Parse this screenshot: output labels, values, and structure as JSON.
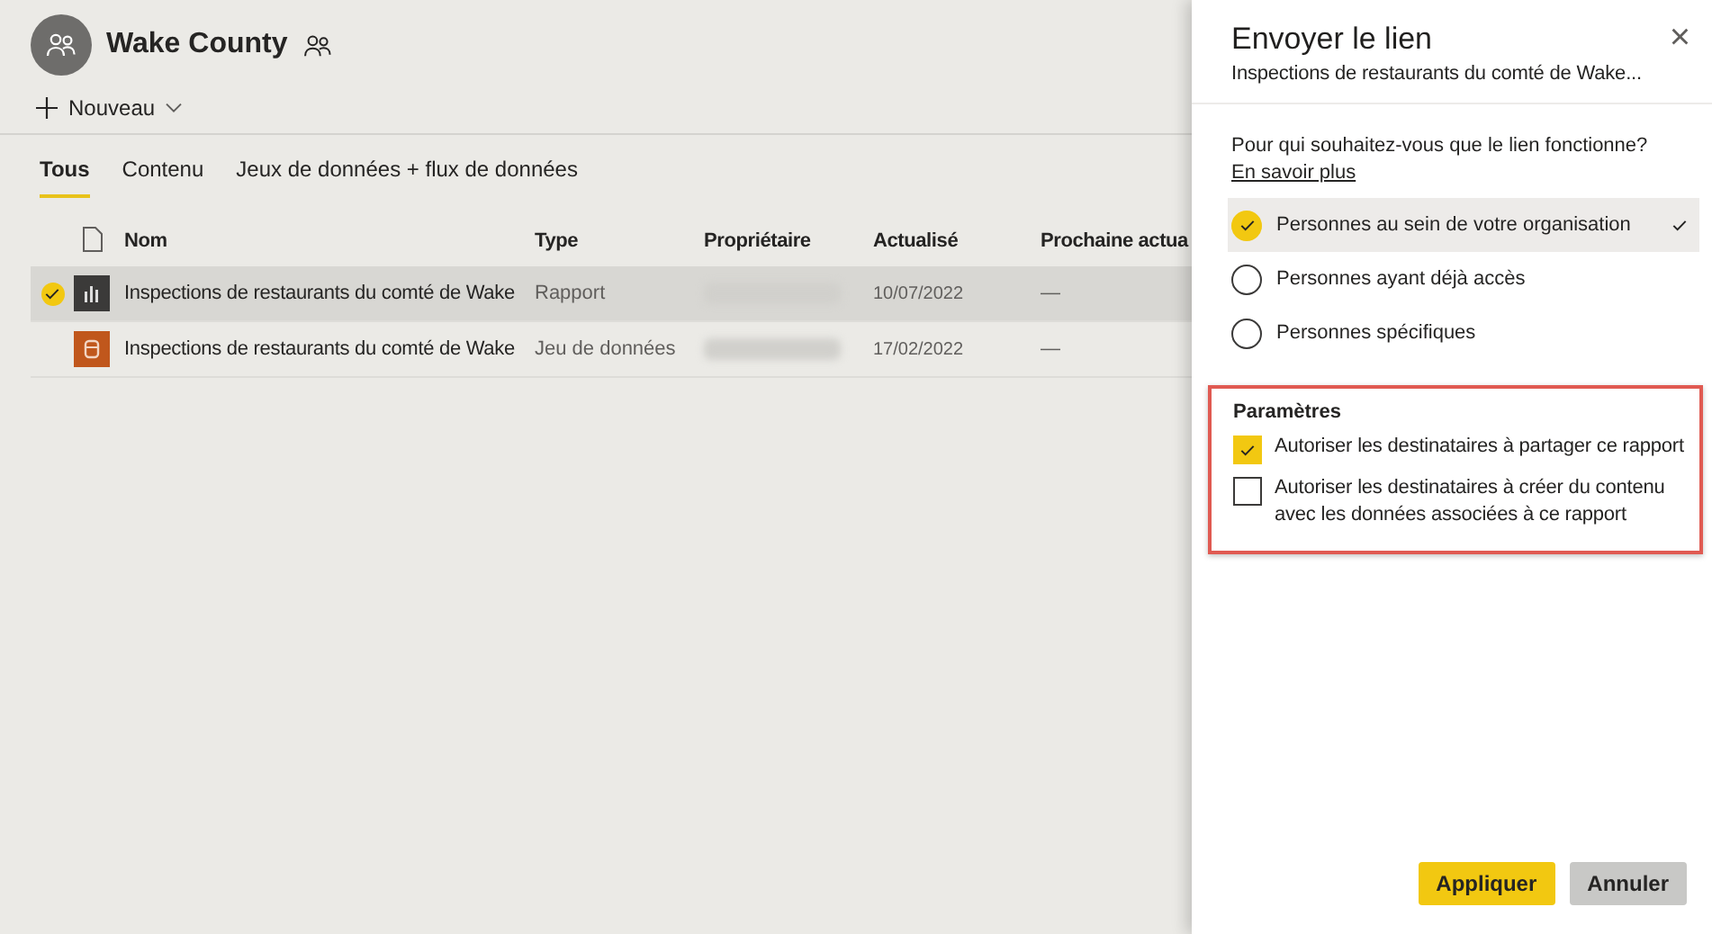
{
  "workspace": {
    "title": "Wake County",
    "new_button": "Nouveau",
    "tabs": [
      {
        "label": "Tous",
        "selected": true
      },
      {
        "label": "Contenu",
        "selected": false
      },
      {
        "label": "Jeux de données + flux de données",
        "selected": false
      }
    ],
    "table": {
      "columns": [
        "Nom",
        "Type",
        "Propriétaire",
        "Actualisé",
        "Prochaine actua"
      ],
      "rows": [
        {
          "kind": "report",
          "selected": true,
          "name": "Inspections de restaurants du comté de Wake",
          "type": "Rapport",
          "owner_hidden": true,
          "refreshed": "10/07/2022",
          "next": "—"
        },
        {
          "kind": "dataset",
          "selected": false,
          "name": "Inspections de restaurants du comté de Wake",
          "type": "Jeu de données",
          "owner_hidden": true,
          "refreshed": "17/02/2022",
          "next": "—"
        }
      ]
    }
  },
  "panel": {
    "title": "Envoyer le lien",
    "subtitle": "Inspections de restaurants du comté de Wake...",
    "close": "×",
    "question": "Pour qui souhaitez-vous que le lien fonctionne?",
    "learn_more": "En savoir plus",
    "options": [
      {
        "label": "Personnes au sein de votre organisation",
        "selected": true
      },
      {
        "label": "Personnes ayant déjà accès",
        "selected": false
      },
      {
        "label": "Personnes spécifiques",
        "selected": false
      }
    ],
    "settings": {
      "highlighted": true,
      "title": "Paramètres",
      "items": [
        {
          "label": "Autoriser les destinataires à partager ce rapport",
          "checked": true
        },
        {
          "label": "Autoriser les destinataires à créer du contenu avec les données associées à ce rapport",
          "checked": false
        }
      ]
    },
    "buttons": [
      {
        "label": "Appliquer",
        "kind": "primary"
      },
      {
        "label": "Annuler",
        "kind": "secondary"
      }
    ]
  }
}
